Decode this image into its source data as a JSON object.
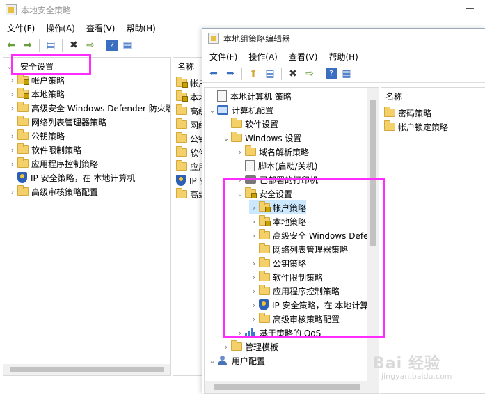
{
  "back_window": {
    "title": "本地安全策略",
    "menu": [
      "文件(F)",
      "操作(A)",
      "查看(V)",
      "帮助(H)"
    ],
    "tree_root": "安全设置",
    "tree_items": [
      {
        "label": "帐户策略",
        "icon": "folder-lock"
      },
      {
        "label": "本地策略",
        "icon": "folder-lock"
      },
      {
        "label": "高级安全 Windows Defender 防火墙",
        "icon": "folder"
      },
      {
        "label": "网络列表管理器策略",
        "icon": "folder"
      },
      {
        "label": "公钥策略",
        "icon": "folder"
      },
      {
        "label": "软件限制策略",
        "icon": "folder"
      },
      {
        "label": "应用程序控制策略",
        "icon": "folder"
      },
      {
        "label": "IP 安全策略，在 本地计算机",
        "icon": "shield"
      },
      {
        "label": "高级审核策略配置",
        "icon": "folder"
      }
    ],
    "list_header": "名称",
    "list_items": [
      "帐户",
      "本地",
      "高级",
      "网络",
      "公钥",
      "软件",
      "应用",
      "IP 安",
      "高级"
    ]
  },
  "front_window": {
    "title": "本地组策略编辑器",
    "menu": [
      "文件(F)",
      "操作(A)",
      "查看(V)",
      "帮助(H)"
    ],
    "tree": {
      "root": "本地计算机 策略",
      "computer_config": "计算机配置",
      "software_settings": "软件设置",
      "windows_settings": "Windows 设置",
      "dns_policy": "域名解析策略",
      "scripts": "脚本(启动/关机)",
      "printers": "已部署的打印机",
      "security_settings": "安全设置",
      "security_children": [
        {
          "label": "帐户策略",
          "icon": "folder-lock",
          "selected": true
        },
        {
          "label": "本地策略",
          "icon": "folder-lock"
        },
        {
          "label": "高级安全 Windows Defender 防火墙",
          "icon": "folder"
        },
        {
          "label": "网络列表管理器策略",
          "icon": "folder"
        },
        {
          "label": "公钥策略",
          "icon": "folder"
        },
        {
          "label": "软件限制策略",
          "icon": "folder"
        },
        {
          "label": "应用程序控制策略",
          "icon": "folder"
        },
        {
          "label": "IP 安全策略，在 本地计算机",
          "icon": "shield"
        },
        {
          "label": "高级审核策略配置",
          "icon": "folder"
        }
      ],
      "qos": "基于策略的 QoS",
      "admin_templates": "管理模板",
      "user_config": "用户配置"
    },
    "list_header": "名称",
    "list_items": [
      "密码策略",
      "帐户锁定策略"
    ]
  },
  "watermark": {
    "text": "Bai 经验",
    "url": "jingyan.baidu.com"
  },
  "colors": {
    "highlight": "#ff2bff",
    "selection": "#cce8ff",
    "folder": "#f3d06a"
  }
}
